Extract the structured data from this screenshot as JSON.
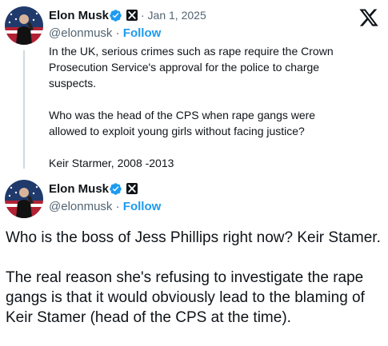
{
  "colors": {
    "follow": "#1d9bf0",
    "verified_badge": "#1d9bf0",
    "secondary_text": "#536471",
    "thread_line": "#cfd9de"
  },
  "quoted_tweet": {
    "author_name": "Elon Musk",
    "handle": "@elonmusk",
    "separator": "·",
    "follow_label": "Follow",
    "date": "· Jan 1, 2025",
    "paragraphs": [
      "In the UK, serious crimes such as rape require the Crown Prosecution Service's approval for the police to charge suspects.",
      "Who was the head of the CPS when rape gangs were allowed to exploit young girls without facing justice?",
      "Keir Starmer, 2008 -2013"
    ]
  },
  "reply_tweet": {
    "author_name": "Elon Musk",
    "handle": "@elonmusk",
    "separator": "·",
    "follow_label": "Follow",
    "paragraphs": [
      "Who is the boss of Jess Phillips right now? Keir Stamer.",
      "The real reason she's refusing to investigate the rape gangs is that it would obviously lead to the blaming of Keir Stamer (head of the CPS at the time)."
    ]
  },
  "icons": {
    "verified": "verified-badge-icon",
    "affiliate": "x-affiliate-icon",
    "platform_logo": "x-logo-icon"
  }
}
